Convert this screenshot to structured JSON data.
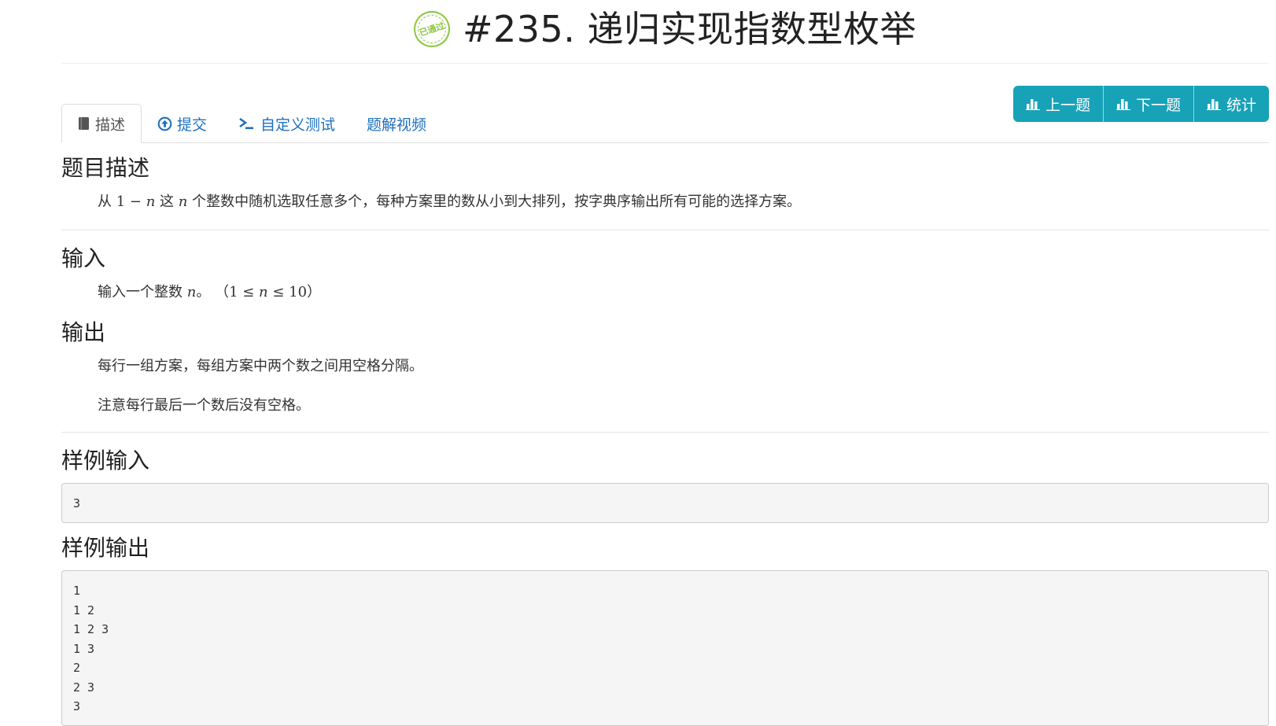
{
  "title": {
    "stamp_text": "已通过",
    "text": "#235. 递归实现指数型枚举"
  },
  "tabs": [
    {
      "label": "描述",
      "icon": "book-icon",
      "active": true
    },
    {
      "label": "提交",
      "icon": "upload-circle-icon",
      "active": false
    },
    {
      "label": "自定义测试",
      "icon": "terminal-icon",
      "active": false
    },
    {
      "label": "题解视频",
      "icon": "",
      "active": false
    }
  ],
  "buttons": [
    {
      "label": "上一题",
      "icon": "bar-chart-icon"
    },
    {
      "label": "下一题",
      "icon": "bar-chart-icon"
    },
    {
      "label": "统计",
      "icon": "bar-chart-icon"
    }
  ],
  "description": {
    "heading": "题目描述",
    "prefix": "从 ",
    "math1_a": "1 − ",
    "math1_n": "n",
    "middle": " 这 ",
    "math2_n": "n",
    "suffix": " 个整数中随机选取任意多个，每种方案里的数从小到大排列，按字典序输出所有可能的选择方案。"
  },
  "input": {
    "heading": "输入",
    "prefix": "输入一个整数 ",
    "math_n": "n",
    "middle": "。 （",
    "math_range_a": "1 ≤ ",
    "math_range_n": "n",
    "math_range_b": " ≤ 10",
    "suffix": "）"
  },
  "output": {
    "heading": "输出",
    "line1": "每行一组方案，每组方案中两个数之间用空格分隔。",
    "line2": "注意每行最后一个数后没有空格。"
  },
  "sample_input": {
    "heading": "样例输入",
    "content": "3"
  },
  "sample_output": {
    "heading": "样例输出",
    "content": "1\n1 2\n1 2 3\n1 3\n2\n2 3\n3"
  },
  "colors": {
    "tab_link": "#1e70bf",
    "button_bg": "#17a2b8",
    "stamp": "#8cc63f"
  }
}
